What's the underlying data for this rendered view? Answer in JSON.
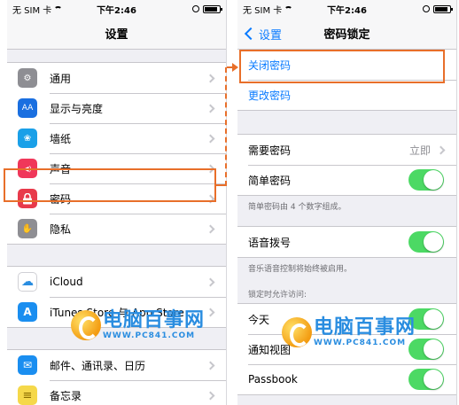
{
  "status_bar": {
    "carrier": "无 SIM 卡",
    "time": "下午2:46"
  },
  "left_screen": {
    "title": "设置",
    "groups": [
      [
        {
          "label": "通用",
          "icon": "gear-icon",
          "color": "#8e8e93",
          "glyph": "⚙"
        },
        {
          "label": "显示与亮度",
          "icon": "display-brightness-icon",
          "color": "#1a6fe0",
          "glyph": "AA"
        },
        {
          "label": "墙纸",
          "icon": "wallpaper-icon",
          "color": "#1aa0e8",
          "glyph": "❀"
        },
        {
          "label": "声音",
          "icon": "speaker-icon",
          "color": "#f0375a",
          "glyph": "◀)"
        },
        {
          "label": "密码",
          "icon": "lock-icon",
          "color": "#e83a4b",
          "glyph": "🔒"
        },
        {
          "label": "隐私",
          "icon": "hand-icon",
          "color": "#8e8e93",
          "glyph": "✋"
        }
      ],
      [
        {
          "label": "iCloud",
          "icon": "cloud-icon",
          "color": "#ffffff",
          "glyph": "☁"
        },
        {
          "label": "iTunes Store 与 App Store",
          "icon": "app-store-icon",
          "color": "#1a8ef0",
          "glyph": "A"
        }
      ],
      [
        {
          "label": "邮件、通讯录、日历",
          "icon": "mail-icon",
          "color": "#1a8ef0",
          "glyph": "✉"
        },
        {
          "label": "备忘录",
          "icon": "notes-icon",
          "color": "#f5d84a",
          "glyph": "≡"
        }
      ]
    ]
  },
  "right_screen": {
    "back_label": "设置",
    "title": "密码锁定",
    "turn_off_label": "关闭密码",
    "change_label": "更改密码",
    "require_label": "需要密码",
    "require_value": "立即",
    "simple_label": "简单密码",
    "simple_note": "简单密码由 4 个数字组成。",
    "voice_label": "语音拨号",
    "voice_note": "音乐语音控制将始终被启用。",
    "lock_section_header": "锁定时允许访问:",
    "lock_items": [
      "今天",
      "通知视图",
      "Passbook"
    ]
  },
  "watermark": {
    "title": "电脑百事网",
    "url": "WWW.PC841.COM"
  },
  "colors": {
    "accent": "#0a7bff",
    "toggle_on": "#4cd964",
    "highlight": "#e86f2a"
  }
}
